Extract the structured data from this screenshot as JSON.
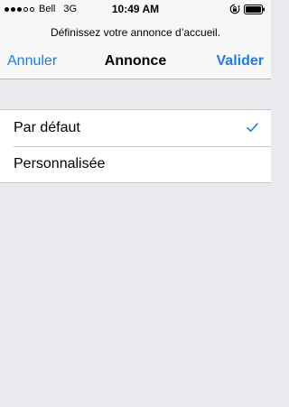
{
  "status_bar": {
    "carrier": "Bell",
    "network": "3G",
    "time": "10:49 AM",
    "signal_bars_filled": 3,
    "signal_bars_total": 5
  },
  "nav": {
    "prompt": "Définissez votre annonce d’accueil.",
    "cancel_label": "Annuler",
    "title": "Annonce",
    "done_label": "Valider"
  },
  "options": {
    "items": [
      {
        "label": "Par défaut",
        "selected": true
      },
      {
        "label": "Personnalisée",
        "selected": false
      }
    ]
  },
  "colors": {
    "accent": "#1a7bf2",
    "background": "#e9e9ee",
    "bar_background": "#f7f7f8",
    "separator": "#c8c7cc"
  },
  "icons": {
    "signal": "signal-dots-icon",
    "rotation_lock": "rotation-lock-icon",
    "battery": "battery-icon",
    "selected": "checkmark-icon"
  }
}
